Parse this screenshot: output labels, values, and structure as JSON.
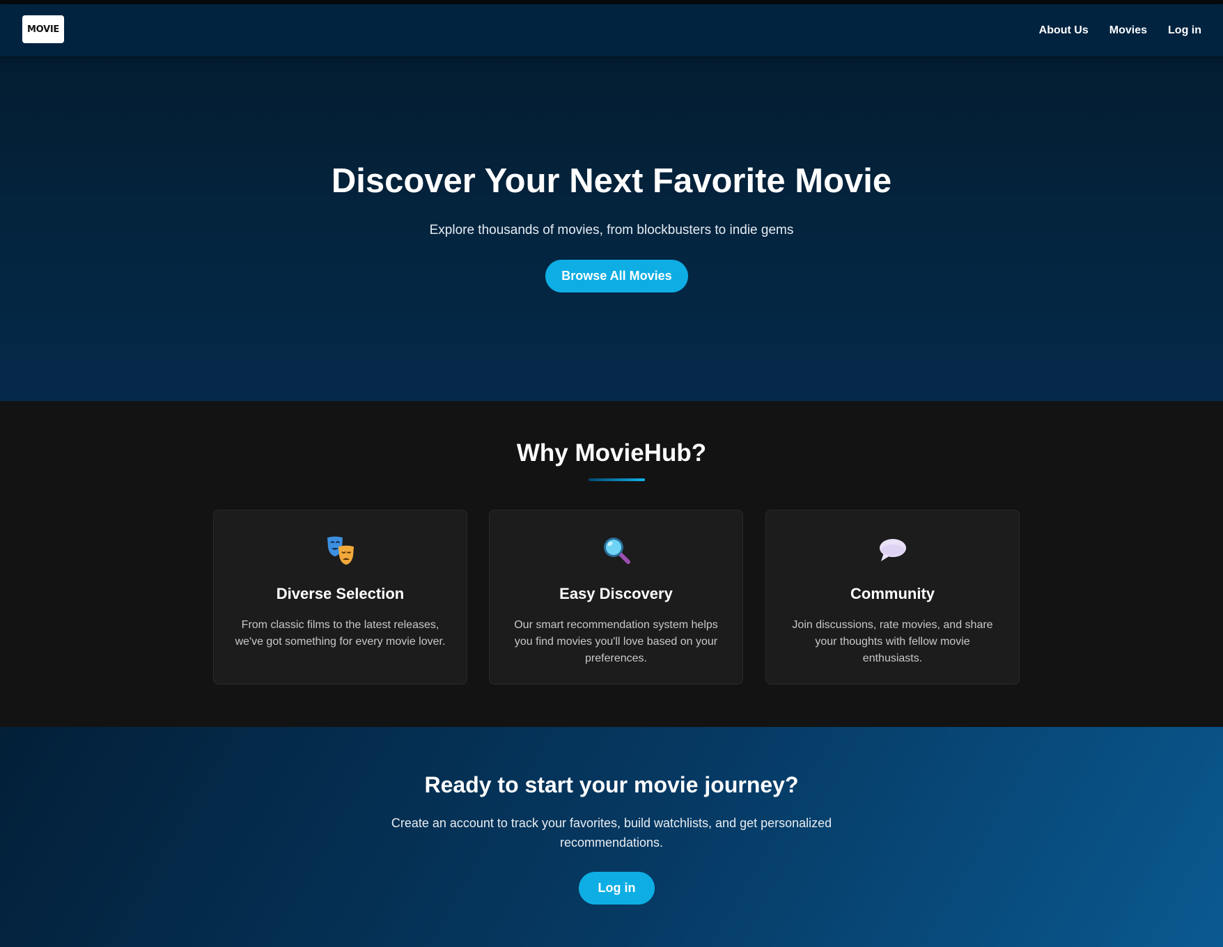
{
  "navbar": {
    "logo_text": "MOVIE",
    "links": [
      {
        "label": "About Us"
      },
      {
        "label": "Movies"
      },
      {
        "label": "Log in"
      }
    ]
  },
  "hero": {
    "title": "Discover Your Next Favorite Movie",
    "subtitle": "Explore thousands of movies, from blockbusters to indie gems",
    "button_label": "Browse All Movies"
  },
  "features": {
    "title": "Why MovieHub?",
    "cards": [
      {
        "icon": "theater-masks-icon",
        "title": "Diverse Selection",
        "text": "From classic films to the latest releases, we've got something for every movie lover."
      },
      {
        "icon": "magnifying-glass-icon",
        "title": "Easy Discovery",
        "text": "Our smart recommendation system helps you find movies you'll love based on your preferences."
      },
      {
        "icon": "speech-bubble-icon",
        "title": "Community",
        "text": "Join discussions, rate movies, and share your thoughts with fellow movie enthusiasts."
      }
    ]
  },
  "cta": {
    "title": "Ready to start your movie journey?",
    "text": "Create an account to track your favorites, build watchlists, and get personalized recommendations.",
    "button_label": "Log in"
  },
  "colors": {
    "accent": "#0eaee5",
    "navbar_bg": "#022340",
    "hero_bg": "#042540",
    "features_bg": "#131313",
    "card_bg": "#1c1c1c"
  }
}
